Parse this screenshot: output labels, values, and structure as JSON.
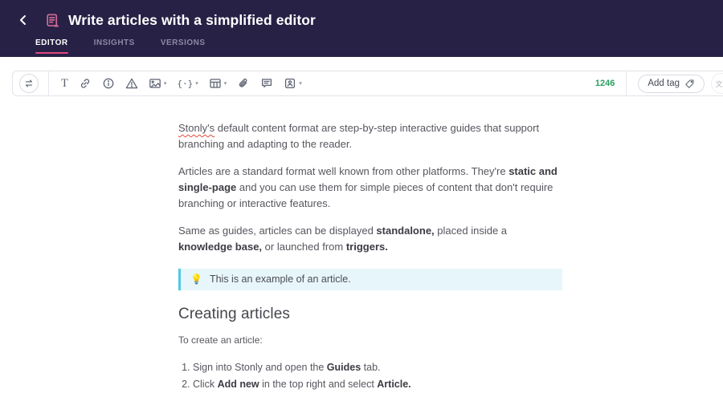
{
  "header": {
    "title": "Write articles with a simplified editor",
    "tabs": [
      {
        "label": "EDITOR",
        "active": true
      },
      {
        "label": "INSIGHTS",
        "active": false
      },
      {
        "label": "VERSIONS",
        "active": false
      }
    ]
  },
  "toolbar": {
    "char_count": "1246",
    "add_tag_label": "Add tag",
    "icons": [
      "swap-arrows",
      "text",
      "link",
      "info",
      "warning",
      "image",
      "code-snippet",
      "table",
      "attachment",
      "note",
      "embed-guide",
      "tag",
      "translate"
    ],
    "code_glyph": "{·}",
    "text_glyph": "T",
    "translate_glyph": "文A",
    "caret_glyph": "▾"
  },
  "article": {
    "paragraphs": [
      {
        "segments": [
          {
            "t": "Stonly's",
            "m": true
          },
          {
            "t": " default content format are step-by-step interactive guides that support branching and adapting to the reader."
          }
        ]
      },
      {
        "segments": [
          {
            "t": "Articles are a standard format well known from other platforms. They're "
          },
          {
            "t": "static and single-page",
            "b": true
          },
          {
            "t": " and you can use them for simple pieces of content that don't require branching or interactive features."
          }
        ]
      },
      {
        "segments": [
          {
            "t": "Same as guides, articles can be displayed "
          },
          {
            "t": "standalone,",
            "b": true
          },
          {
            "t": " placed inside a "
          },
          {
            "t": "knowledge base,",
            "b": true
          },
          {
            "t": " or launched from "
          },
          {
            "t": "triggers.",
            "b": true
          }
        ]
      }
    ],
    "callout": {
      "emoji": "💡",
      "text": "This is an example of an article."
    },
    "heading": "Creating articles",
    "intro": "To create an article:",
    "list": [
      {
        "segments": [
          {
            "t": "Sign into Stonly and open the "
          },
          {
            "t": "Guides",
            "b": true
          },
          {
            "t": " tab."
          }
        ]
      },
      {
        "segments": [
          {
            "t": "Click "
          },
          {
            "t": "Add new",
            "b": true
          },
          {
            "t": " in the top right and select "
          },
          {
            "t": "Article.",
            "b": true
          }
        ]
      }
    ]
  },
  "colors": {
    "header_bg": "#282146",
    "accent_pink": "#e0487e",
    "icon_pink": "#cf6a96",
    "count_green": "#2aa05f",
    "callout_bg": "#e7f6fb",
    "callout_border": "#52c7e4",
    "toolbar_icon": "#5b6170"
  }
}
